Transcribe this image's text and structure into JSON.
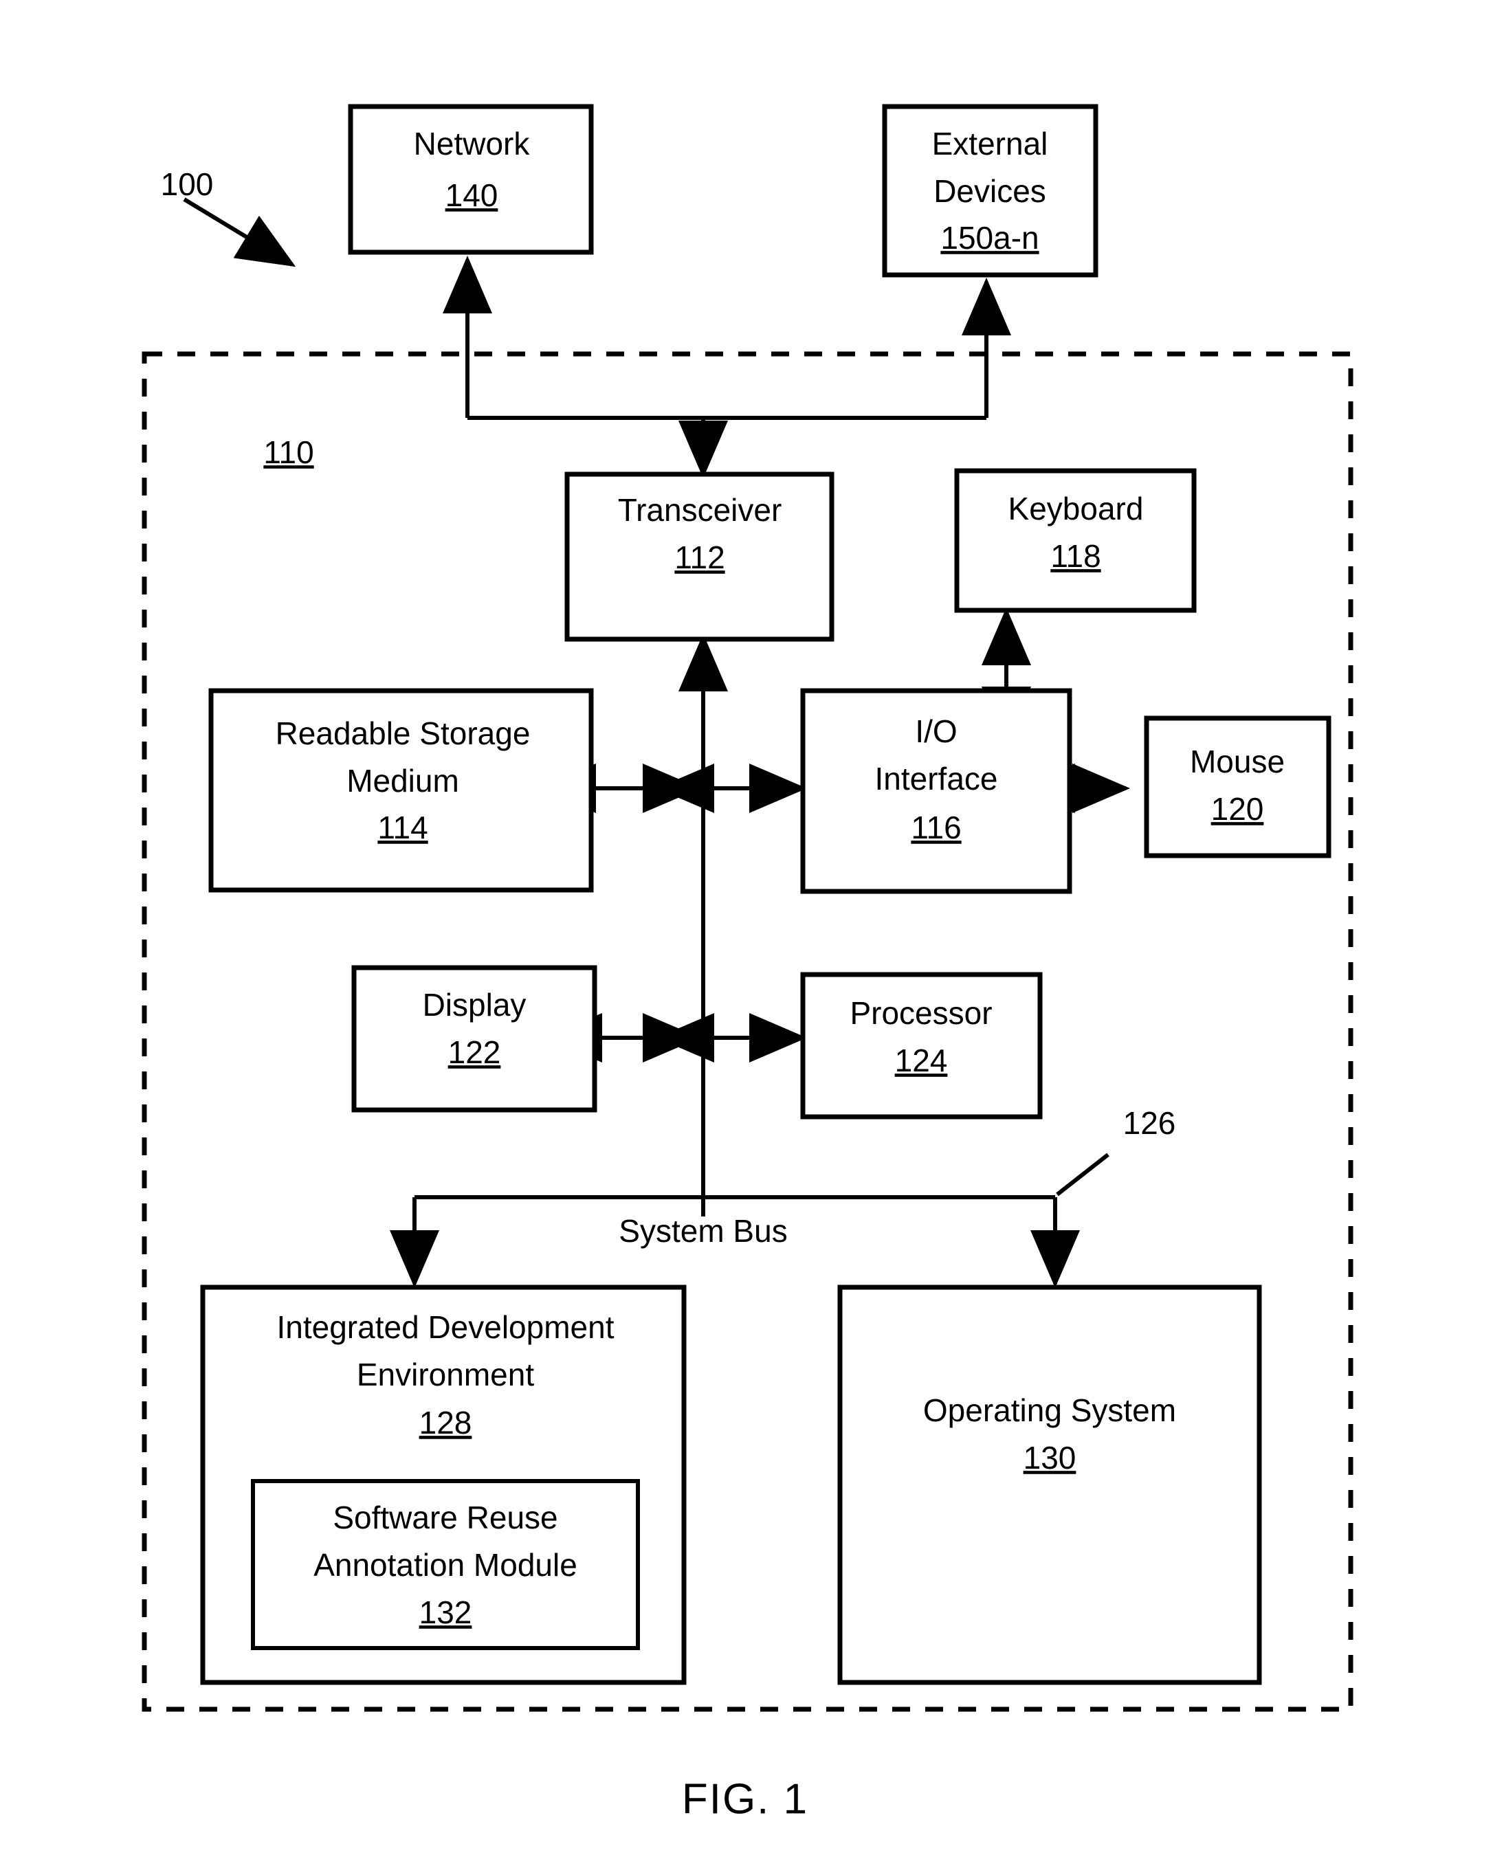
{
  "figure": {
    "caption": "FIG. 1",
    "system_ref": "100",
    "enclosure_ref": "110",
    "bus_ref": "126"
  },
  "blocks": {
    "network": {
      "label": "Network",
      "ref": "140"
    },
    "external": {
      "label_line1": "External",
      "label_line2": "Devices",
      "ref": "150a-n"
    },
    "transceiver": {
      "label": "Transceiver",
      "ref": "112"
    },
    "keyboard": {
      "label": "Keyboard",
      "ref": "118"
    },
    "storage": {
      "label_line1": "Readable Storage",
      "label_line2": "Medium",
      "ref": "114"
    },
    "io": {
      "label_line1": "I/O",
      "label_line2": "Interface",
      "ref": "116"
    },
    "mouse": {
      "label": "Mouse",
      "ref": "120"
    },
    "display": {
      "label": "Display",
      "ref": "122"
    },
    "processor": {
      "label": "Processor",
      "ref": "124"
    },
    "bus": {
      "label": "System Bus"
    },
    "ide": {
      "label_line1": "Integrated Development",
      "label_line2": "Environment",
      "ref": "128"
    },
    "module": {
      "label_line1": "Software Reuse",
      "label_line2": "Annotation Module",
      "ref": "132"
    },
    "os": {
      "label": "Operating System",
      "ref": "130"
    }
  },
  "colors": {
    "stroke": "#000000",
    "fill": "#ffffff"
  }
}
